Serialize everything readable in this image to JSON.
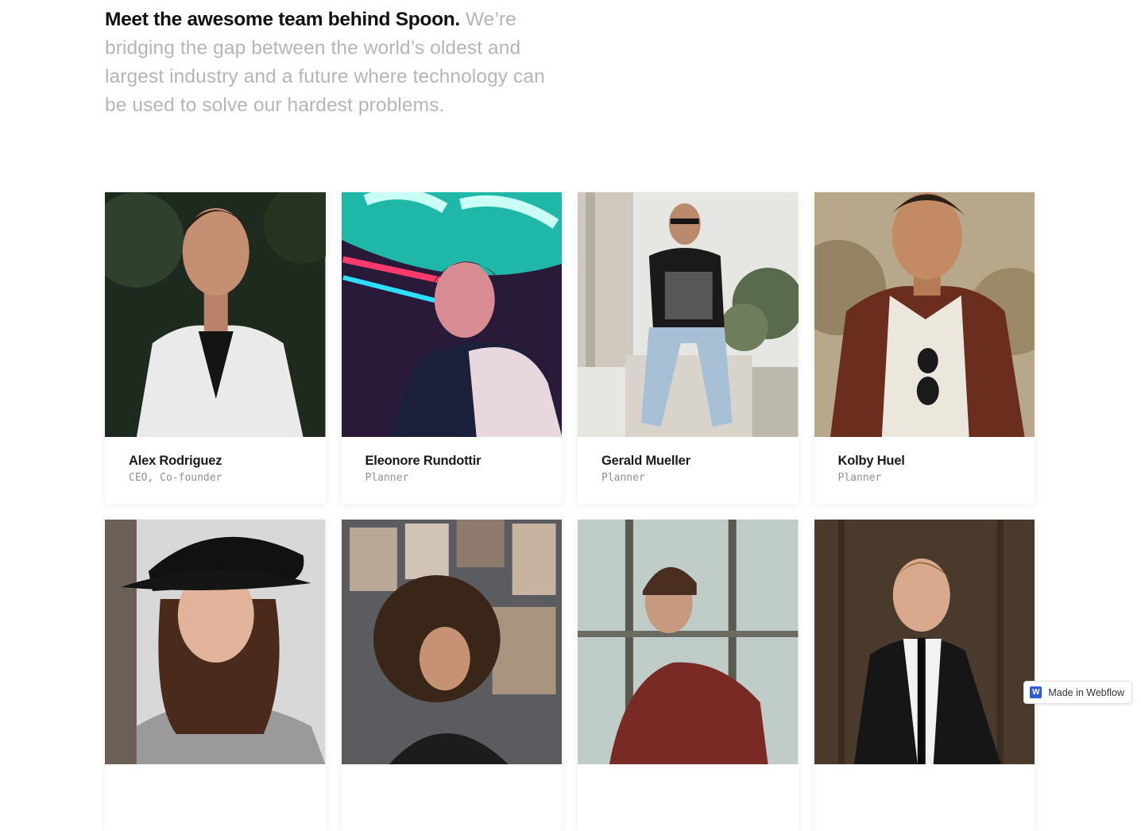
{
  "intro": {
    "lead": "Meet the awesome team behind Spoon.",
    "body": " We’re bridging the gap between the world’s oldest and largest industry and a future where technology can be used to solve our hardest problems."
  },
  "team": [
    {
      "name": "Alex Rodriguez",
      "role": "CEO, Co-founder"
    },
    {
      "name": "Eleonore Rundottir",
      "role": "Planner"
    },
    {
      "name": "Gerald Mueller",
      "role": "Planner"
    },
    {
      "name": "Kolby Huel",
      "role": "Planner"
    },
    {
      "name": "",
      "role": ""
    },
    {
      "name": "",
      "role": ""
    },
    {
      "name": "",
      "role": ""
    },
    {
      "name": "",
      "role": ""
    }
  ],
  "badge": {
    "label": "Made in Webflow",
    "logo_letter": "W"
  },
  "colors": {
    "heading": "#111111",
    "muted": "#b5b5b5",
    "role": "#8f8f8f",
    "webflow_blue": "#2d5cd6"
  }
}
